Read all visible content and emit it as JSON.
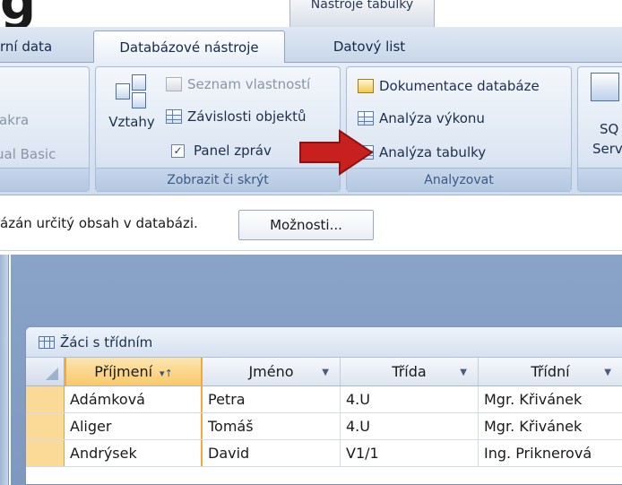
{
  "title_fragment": "g",
  "context_tab": {
    "label": "Nástroje tabulky"
  },
  "tabs": [
    {
      "label": "rní data",
      "active": false
    },
    {
      "label": "Databázové nástroje",
      "active": true
    },
    {
      "label": "Datový list",
      "active": false
    }
  ],
  "ribbon": {
    "left_group": {
      "items": [
        "akra",
        "ual Basic"
      ]
    },
    "show_hide": {
      "label": "Zobrazit či skrýt",
      "relations": "Vztahy",
      "property_sheet": "Seznam vlastností",
      "object_dependencies": "Závislosti objektů",
      "message_bar": "Panel zpráv",
      "message_bar_checked": true
    },
    "analyze": {
      "label": "Analyzovat",
      "documenter": "Dokumentace databáze",
      "performance": "Analýza výkonu",
      "table": "Analýza tabulky"
    },
    "right_group": {
      "line1": "SQ",
      "line2": "Serv",
      "label": "I"
    }
  },
  "message_bar": {
    "text": "ázán určitý obsah v databázi.",
    "options_button": "Možnosti..."
  },
  "table_window": {
    "title": "Žáci s třídním",
    "columns": [
      "Příjmení",
      "Jméno",
      "Třída",
      "Třídní"
    ],
    "rows": [
      [
        "Adámková",
        "Petra",
        "4.U",
        "Mgr. Křivánek"
      ],
      [
        "Aliger",
        "Tomáš",
        "4.U",
        "Mgr. Křivánek"
      ],
      [
        "Andrýsek",
        "David",
        "V1/1",
        "Ing. Priknerová"
      ]
    ]
  },
  "colors": {
    "arrow": "#c8201e",
    "selector": "#fbd996",
    "sorted_border": "#f2a93b"
  }
}
